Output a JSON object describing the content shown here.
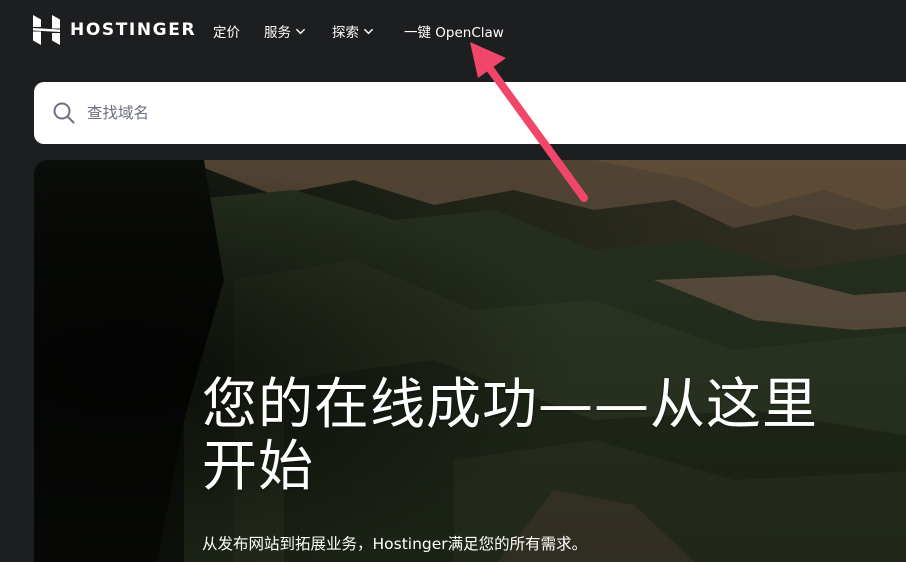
{
  "brand": {
    "name": "HOSTINGER"
  },
  "nav": {
    "items": [
      {
        "label": "定价",
        "has_dropdown": false
      },
      {
        "label": "服务",
        "has_dropdown": true
      },
      {
        "label": "探索",
        "has_dropdown": true
      },
      {
        "label": "一键 OpenClaw",
        "has_dropdown": false
      }
    ]
  },
  "search": {
    "placeholder": "查找域名",
    "icon": "search-icon"
  },
  "hero": {
    "title": "您的在线成功——从这里开始",
    "subtitle": "从发布网站到拓展业务，Hostinger满足您的所有需求。"
  },
  "colors": {
    "background": "#1d1e20",
    "text": "#ffffff",
    "search_bg": "#ffffff",
    "placeholder": "#6d7081",
    "annotation_arrow": "#f0466a"
  }
}
